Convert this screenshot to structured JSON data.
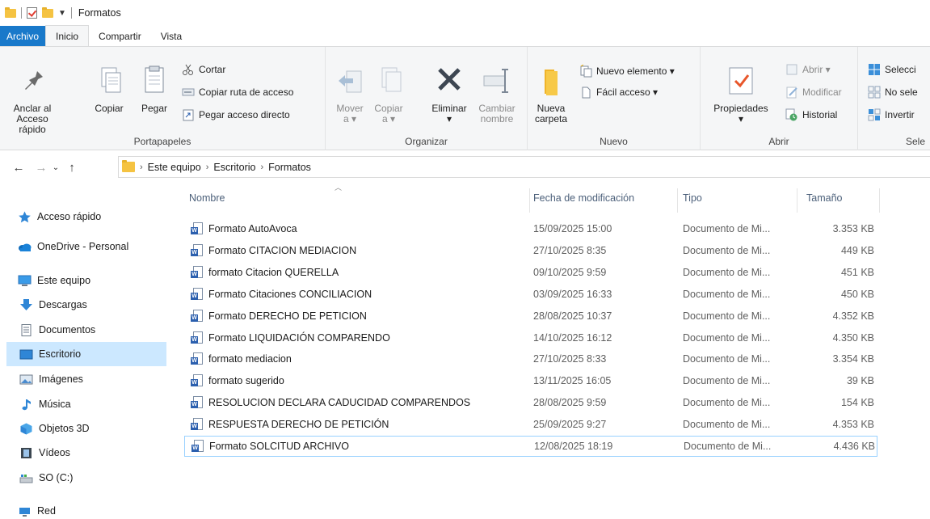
{
  "window": {
    "title": "Formatos"
  },
  "ribbon_tabs": [
    "Archivo",
    "Inicio",
    "Compartir",
    "Vista"
  ],
  "ribbon": {
    "portapapeles": {
      "label": "Portapapeles",
      "pin": [
        "Anclar al",
        "Acceso rápido"
      ],
      "copy": "Copiar",
      "paste": "Pegar",
      "cut": "Cortar",
      "copy_path": "Copiar ruta de acceso",
      "paste_shortcut": "Pegar acceso directo"
    },
    "organizar": {
      "label": "Organizar",
      "move": [
        "Mover",
        "a ▾"
      ],
      "copy_to": [
        "Copiar",
        "a ▾"
      ],
      "delete": [
        "Eliminar",
        "▾"
      ],
      "rename": [
        "Cambiar",
        "nombre"
      ]
    },
    "nuevo": {
      "label": "Nuevo",
      "new_folder": [
        "Nueva",
        "carpeta"
      ],
      "new_item": "Nuevo elemento ▾",
      "easy_access": "Fácil acceso ▾"
    },
    "abrir": {
      "label": "Abrir",
      "properties": [
        "Propiedades",
        "▾"
      ],
      "open": "Abrir ▾",
      "edit": "Modificar",
      "history": "Historial"
    },
    "seleccionar": {
      "label": "Sele",
      "select_all": "Selecci",
      "select_none": "No sele",
      "invert": "Invertir"
    }
  },
  "address": {
    "crumbs": [
      "Este equipo",
      "Escritorio",
      "Formatos"
    ]
  },
  "nav": {
    "quick_access": "Acceso rápido",
    "onedrive": "OneDrive - Personal",
    "this_pc": "Este equipo",
    "items": [
      "Descargas",
      "Documentos",
      "Escritorio",
      "Imágenes",
      "Música",
      "Objetos 3D",
      "Vídeos",
      "SO (C:)"
    ],
    "network": "Red"
  },
  "columns": {
    "name": "Nombre",
    "date": "Fecha de modificación",
    "type": "Tipo",
    "size": "Tamaño"
  },
  "files": [
    {
      "name": "Formato AutoAvoca",
      "date": "15/09/2025 15:00",
      "type": "Documento de Mi...",
      "size": "3.353 KB"
    },
    {
      "name": "Formato CITACION MEDIACION",
      "date": "27/10/2025 8:35",
      "type": "Documento de Mi...",
      "size": "449 KB"
    },
    {
      "name": "formato Citacion QUERELLA",
      "date": "09/10/2025 9:59",
      "type": "Documento de Mi...",
      "size": "451 KB"
    },
    {
      "name": "Formato Citaciones CONCILIACION",
      "date": "03/09/2025 16:33",
      "type": "Documento de Mi...",
      "size": "450 KB"
    },
    {
      "name": "Formato DERECHO DE PETICION",
      "date": "28/08/2025 10:37",
      "type": "Documento de Mi...",
      "size": "4.352 KB"
    },
    {
      "name": "Formato LIQUIDACIÓN COMPARENDO",
      "date": "14/10/2025 16:12",
      "type": "Documento de Mi...",
      "size": "4.350 KB"
    },
    {
      "name": "formato mediacion",
      "date": "27/10/2025 8:33",
      "type": "Documento de Mi...",
      "size": "3.354 KB"
    },
    {
      "name": "formato sugerido",
      "date": "13/11/2025 16:05",
      "type": "Documento de Mi...",
      "size": "39 KB"
    },
    {
      "name": "RESOLUCION DECLARA CADUCIDAD COMPARENDOS",
      "date": "28/08/2025 9:59",
      "type": "Documento de Mi...",
      "size": "154 KB"
    },
    {
      "name": "RESPUESTA DERECHO DE PETICIÓN",
      "date": "25/09/2025 9:27",
      "type": "Documento de Mi...",
      "size": "4.353 KB"
    },
    {
      "name": "Formato SOLCITUD ARCHIVO",
      "date": "12/08/2025 18:19",
      "type": "Documento de Mi...",
      "size": "4.436 KB"
    }
  ],
  "colors": {
    "accent": "#1979ca",
    "selection": "#cce8ff",
    "folder": "#f5c342",
    "word": "#2b5fae"
  }
}
